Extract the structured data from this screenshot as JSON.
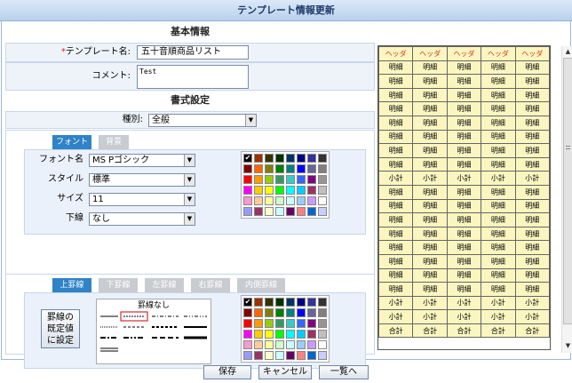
{
  "title": "テンプレート情報更新",
  "basic": {
    "heading": "基本情報",
    "template_label": "テンプレート名:",
    "required_mark": "*",
    "template_value": "五十音順商品リスト",
    "comment_label": "コメント:",
    "comment_value": "Test"
  },
  "format": {
    "heading": "書式設定",
    "type_label": "種別:",
    "type_value": "全般"
  },
  "font_tabs": [
    "フォント",
    "背景"
  ],
  "font_fields": [
    {
      "label": "フォント名",
      "value": "MS Pゴシック"
    },
    {
      "label": "スタイル",
      "value": "標準"
    },
    {
      "label": "サイズ",
      "value": "11"
    },
    {
      "label": "下線",
      "value": "なし"
    }
  ],
  "border_tabs": [
    "上罫線",
    "下罫線",
    "左罫線",
    "右罫線",
    "内側罫線"
  ],
  "border": {
    "default_button": [
      "罫線の",
      "既定値",
      "に設定"
    ],
    "none_label": "罫線なし"
  },
  "palette": [
    "#000000",
    "#993300",
    "#333300",
    "#003300",
    "#003366",
    "#000080",
    "#333399",
    "#333333",
    "#800000",
    "#ff6600",
    "#808000",
    "#008000",
    "#008080",
    "#0000ff",
    "#666699",
    "#808080",
    "#ff0000",
    "#ff9900",
    "#99cc00",
    "#339966",
    "#33cccc",
    "#3366ff",
    "#800080",
    "#969696",
    "#ff00ff",
    "#ffcc00",
    "#ffff00",
    "#00ff00",
    "#00ffff",
    "#00ccff",
    "#993366",
    "#c0c0c0",
    "#ff99cc",
    "#ffcc99",
    "#ffff99",
    "#ccffcc",
    "#ccffff",
    "#99ccff",
    "#cc99ff",
    "#ffffff",
    "#9999ff",
    "#993366",
    "#ffffcc",
    "#ccffff",
    "#660066",
    "#ff8080",
    "#0066cc",
    "#ccccff"
  ],
  "palette_check": "✔",
  "preview": {
    "header": [
      "ヘッダ",
      "ヘッダ",
      "ヘッダ",
      "ヘッダ",
      "ヘッダ"
    ],
    "rows": [
      [
        "明細",
        "明細",
        "明細",
        "明細",
        "明細"
      ],
      [
        "明細",
        "明細",
        "明細",
        "明細",
        "明細"
      ],
      [
        "明細",
        "明細",
        "明細",
        "明細",
        "明細"
      ],
      [
        "明細",
        "明細",
        "明細",
        "明細",
        "明細"
      ],
      [
        "明細",
        "明細",
        "明細",
        "明細",
        "明細"
      ],
      [
        "明細",
        "明細",
        "明細",
        "明細",
        "明細"
      ],
      [
        "明細",
        "明細",
        "明細",
        "明細",
        "明細"
      ],
      [
        "明細",
        "明細",
        "明細",
        "明細",
        "明細"
      ],
      [
        "小計",
        "小計",
        "小計",
        "小計",
        "小計"
      ],
      [
        "明細",
        "明細",
        "明細",
        "明細",
        "明細"
      ],
      [
        "明細",
        "明細",
        "明細",
        "明細",
        "明細"
      ],
      [
        "明細",
        "明細",
        "明細",
        "明細",
        "明細"
      ],
      [
        "明細",
        "明細",
        "明細",
        "明細",
        "明細"
      ],
      [
        "明細",
        "明細",
        "明細",
        "明細",
        "明細"
      ],
      [
        "明細",
        "明細",
        "明細",
        "明細",
        "明細"
      ],
      [
        "明細",
        "明細",
        "明細",
        "明細",
        "明細"
      ],
      [
        "明細",
        "明細",
        "明細",
        "明細",
        "明細"
      ],
      [
        "小計",
        "小計",
        "小計",
        "小計",
        "小計"
      ],
      [
        "小計",
        "小計",
        "小計",
        "小計",
        "小計"
      ],
      [
        "合計",
        "合計",
        "合計",
        "合計",
        "合計"
      ]
    ]
  },
  "buttons": {
    "save": "保存",
    "cancel": "キャンセル",
    "list": "一覧へ"
  }
}
